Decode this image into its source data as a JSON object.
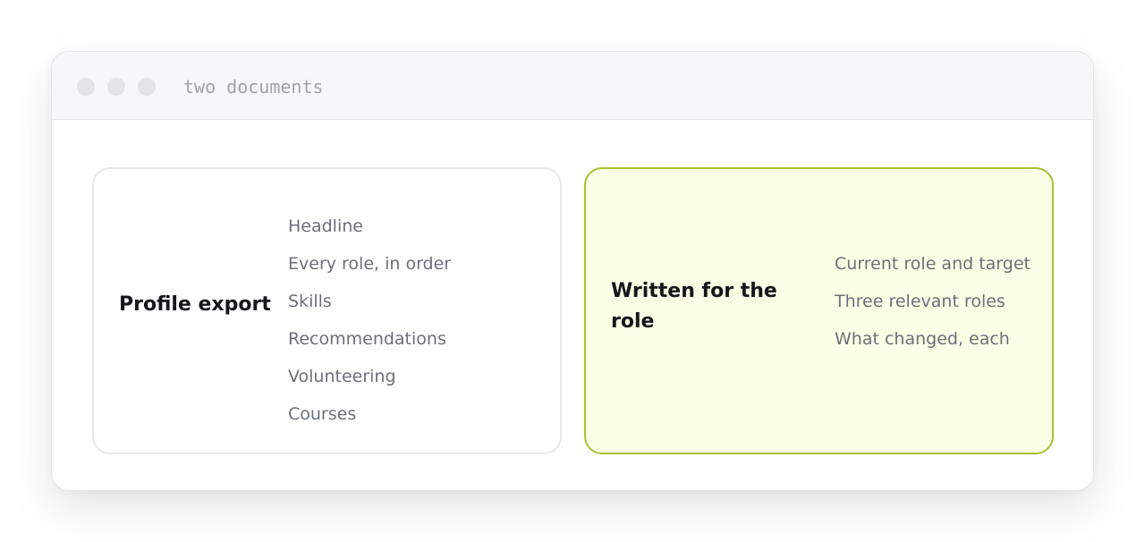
{
  "window": {
    "title": "two documents"
  },
  "colors": {
    "accent_border": "#a8c234",
    "accent_fill": "#fbffe6",
    "muted_text": "#6b7078",
    "heading_text": "#15171a"
  },
  "cards": [
    {
      "title": "Profile export",
      "items": [
        "Headline",
        "Every role, in order",
        "Skills",
        "Recommendations",
        "Volunteering",
        "Courses"
      ]
    },
    {
      "title": "Written for the role",
      "items": [
        "Current role and target",
        "Three relevant roles",
        "What changed, each"
      ]
    }
  ]
}
